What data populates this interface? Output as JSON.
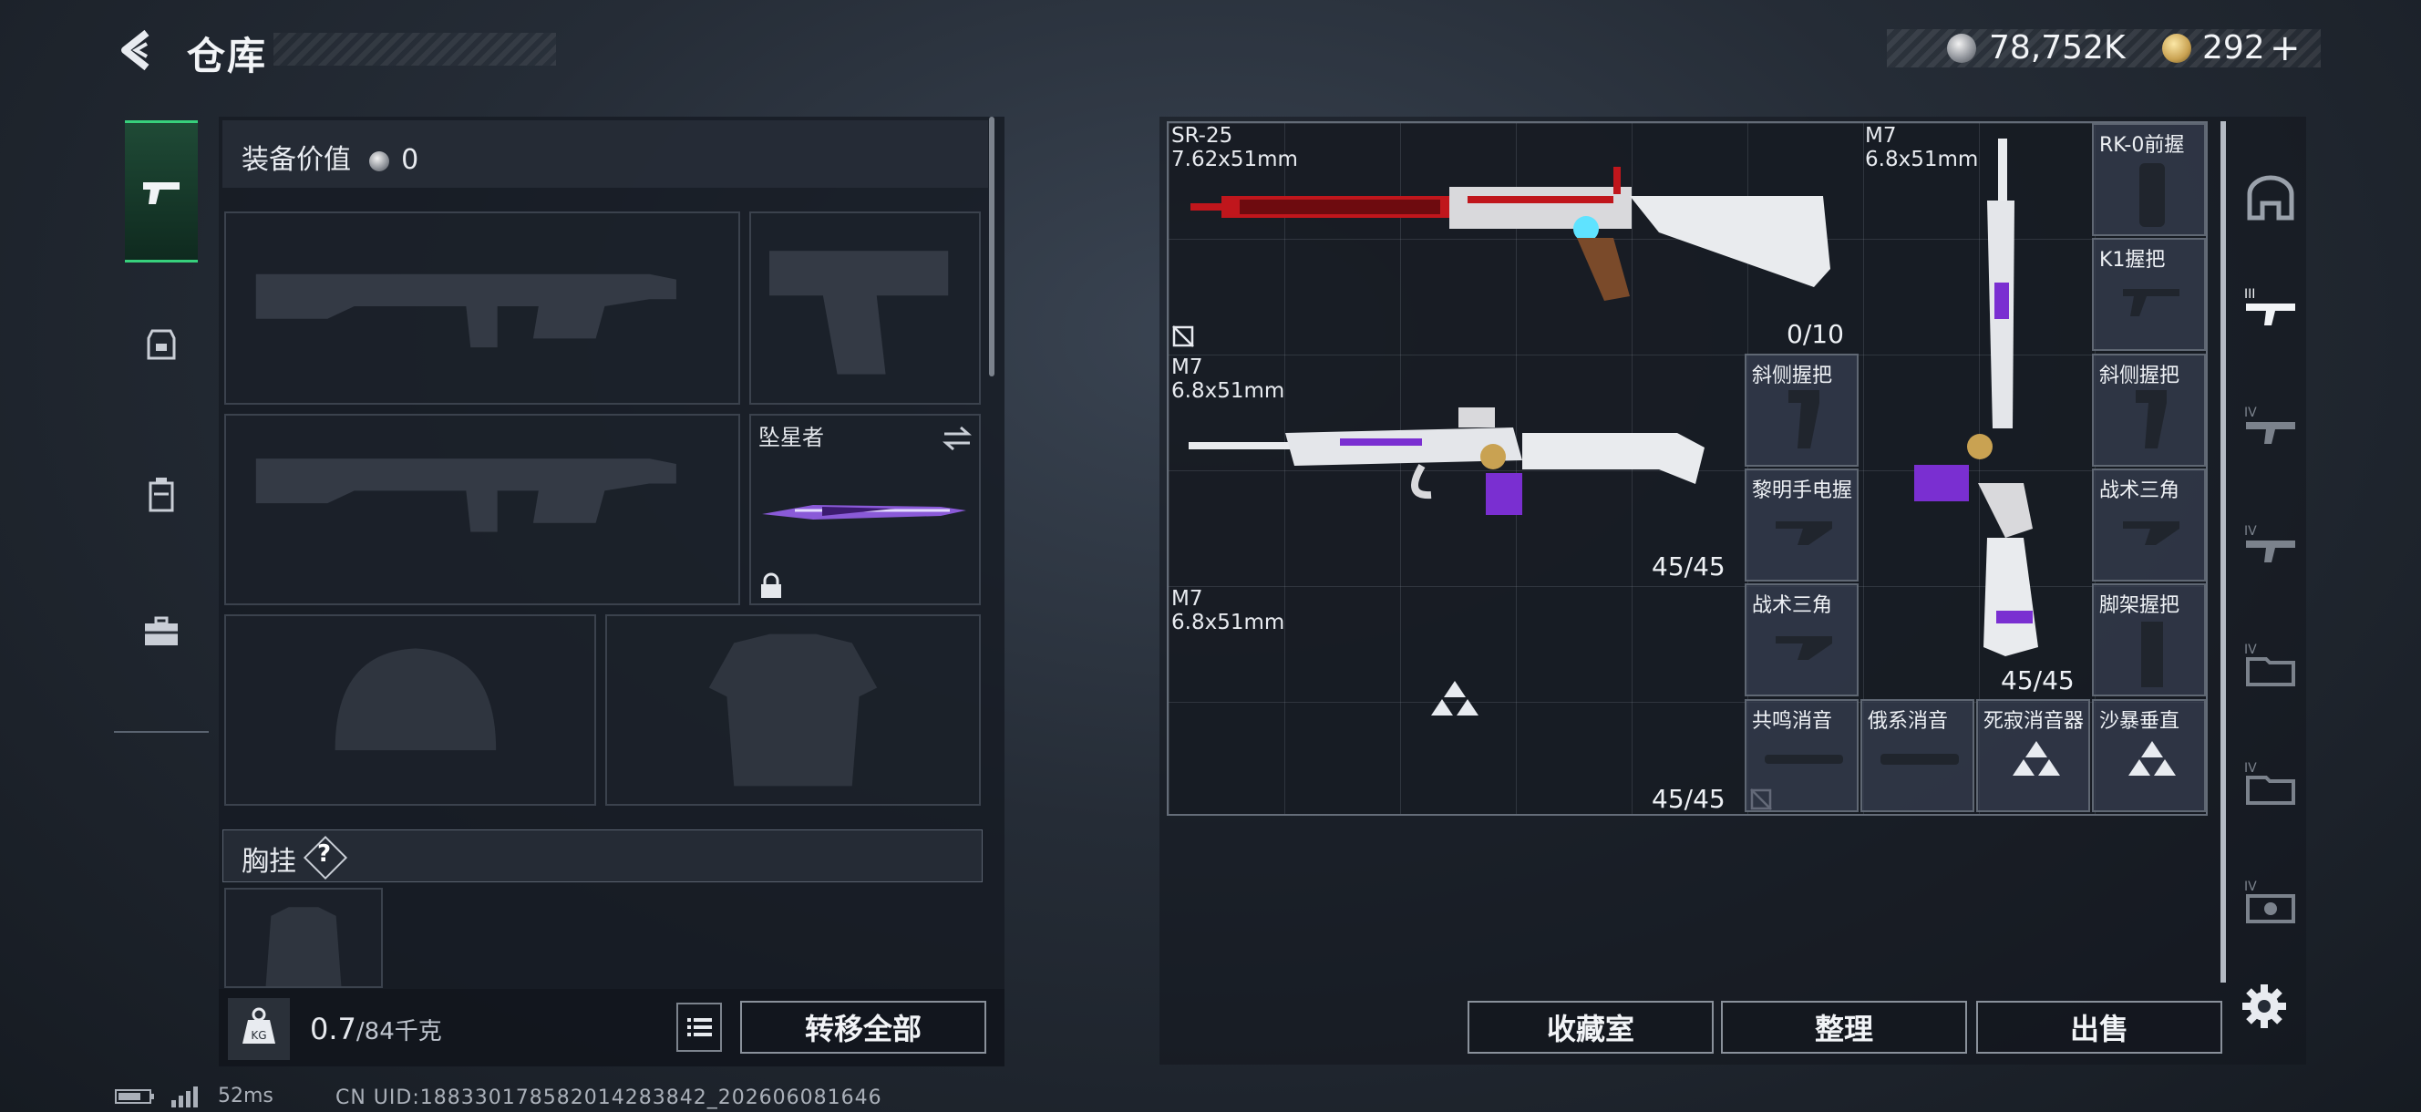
{
  "header": {
    "title": "仓库",
    "currency_silver": "78,752K",
    "currency_gold": "292",
    "add_symbol": "+"
  },
  "left_tabs": [
    {
      "icon": "pistol-icon",
      "active": true
    },
    {
      "icon": "backpack-icon",
      "active": false
    },
    {
      "icon": "bag-icon",
      "active": false
    },
    {
      "icon": "briefcase-icon",
      "active": false
    }
  ],
  "loadout": {
    "value_label": "装备价值",
    "value": "0",
    "melee_name": "坠星者",
    "chest_label": "胸挂",
    "help": "?"
  },
  "footer_left": {
    "kg_label": "KG",
    "weight_current": "0.7",
    "weight_max": "/84千克",
    "transfer_all": "转移全部"
  },
  "stash": {
    "weapons": [
      {
        "name": "SR-25",
        "caliber": "7.62x51mm",
        "ammo": "0/10"
      },
      {
        "name": "M7",
        "caliber": "6.8x51mm",
        "ammo": "45/45"
      },
      {
        "name": "M7",
        "caliber": "6.8x51mm",
        "ammo": "45/45"
      },
      {
        "name": "M7",
        "caliber": "6.8x51mm",
        "ammo": "45/45"
      }
    ],
    "attachments": [
      {
        "name": "RK-0前握"
      },
      {
        "name": "K1握把"
      },
      {
        "name": "斜侧握把"
      },
      {
        "name": "斜侧握把"
      },
      {
        "name": "黎明手电握"
      },
      {
        "name": "战术三角"
      },
      {
        "name": "战术三角"
      },
      {
        "name": "脚架握把"
      },
      {
        "name": "共鸣消音"
      },
      {
        "name": "俄系消音"
      },
      {
        "name": "死寂消音器"
      },
      {
        "name": "沙暴垂直"
      }
    ]
  },
  "rail": [
    {
      "icon": "stash-home-icon",
      "label": ""
    },
    {
      "icon": "tier-iii-weapon-icon",
      "label": "III"
    },
    {
      "icon": "tier-iv-weapon-icon",
      "label": "IV"
    },
    {
      "icon": "tier-iv-weapon-icon",
      "label": "IV"
    },
    {
      "icon": "tier-iv-folder-icon",
      "label": "IV"
    },
    {
      "icon": "tier-iv-folder-icon",
      "label": "IV"
    },
    {
      "icon": "tier-iv-gear-icon",
      "label": "IV"
    }
  ],
  "bottom_buttons": {
    "collection": "收藏室",
    "sort": "整理",
    "sell": "出售"
  },
  "status": {
    "ping": "52ms",
    "uid": "CN UID:188330178582014283842_202606081646"
  },
  "colors": {
    "accent_green": "#37d07c",
    "attachment_cell": "#373e50",
    "weapon_purple": "#7a2fd1",
    "weapon_red": "#c0161c"
  }
}
